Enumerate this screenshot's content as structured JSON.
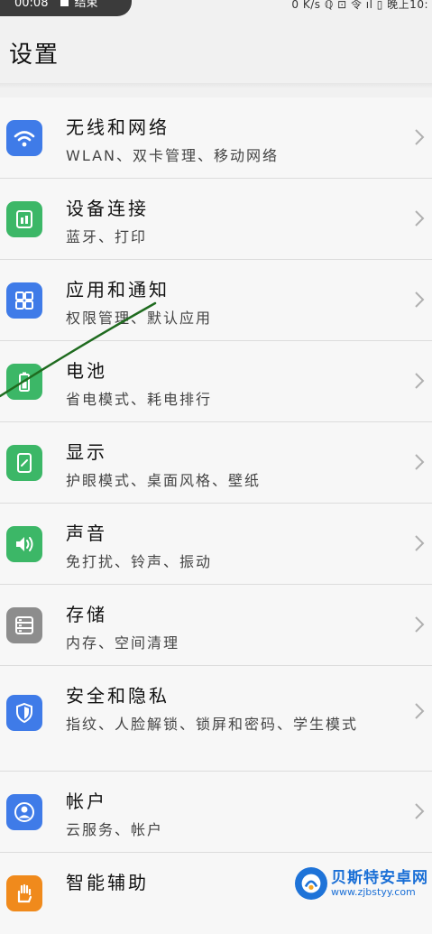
{
  "status_bar": {
    "time": "00:08",
    "stop_label": "结束",
    "right_text": "0 K/s ℚ ⊡ 令 ıl  ▯ 晚上10:"
  },
  "page": {
    "title": "设置"
  },
  "settings": [
    {
      "title": "无线和网络",
      "subtitle": "WLAN、双卡管理、移动网络",
      "icon": "wifi-icon",
      "color": "#3f7be8"
    },
    {
      "title": "设备连接",
      "subtitle": "蓝牙、打印",
      "icon": "device-connection-icon",
      "color": "#3cb767"
    },
    {
      "title": "应用和通知",
      "subtitle": "权限管理、默认应用",
      "icon": "apps-grid-icon",
      "color": "#3f7be8"
    },
    {
      "title": "电池",
      "subtitle": "省电模式、耗电排行",
      "icon": "battery-icon",
      "color": "#3cb767"
    },
    {
      "title": "显示",
      "subtitle": "护眼模式、桌面风格、壁纸",
      "icon": "display-icon",
      "color": "#3cb767"
    },
    {
      "title": "声音",
      "subtitle": "免打扰、铃声、振动",
      "icon": "speaker-icon",
      "color": "#3cb767"
    },
    {
      "title": "存储",
      "subtitle": "内存、空间清理",
      "icon": "storage-icon",
      "color": "#8d8d8d"
    },
    {
      "title": "安全和隐私",
      "subtitle": "指纹、人脸解锁、锁屏和密码、学生模式",
      "icon": "shield-icon",
      "color": "#3f7be8"
    },
    {
      "title": "帐户",
      "subtitle": "云服务、帐户",
      "icon": "account-icon",
      "color": "#3f7be8"
    },
    {
      "title": "智能辅助",
      "subtitle": "",
      "icon": "hand-icon",
      "color": "#f08a1c"
    }
  ],
  "watermark": {
    "name": "贝斯特安卓网",
    "url": "www.zjbstyy.com"
  },
  "annotation_color": "#1f6b1f"
}
